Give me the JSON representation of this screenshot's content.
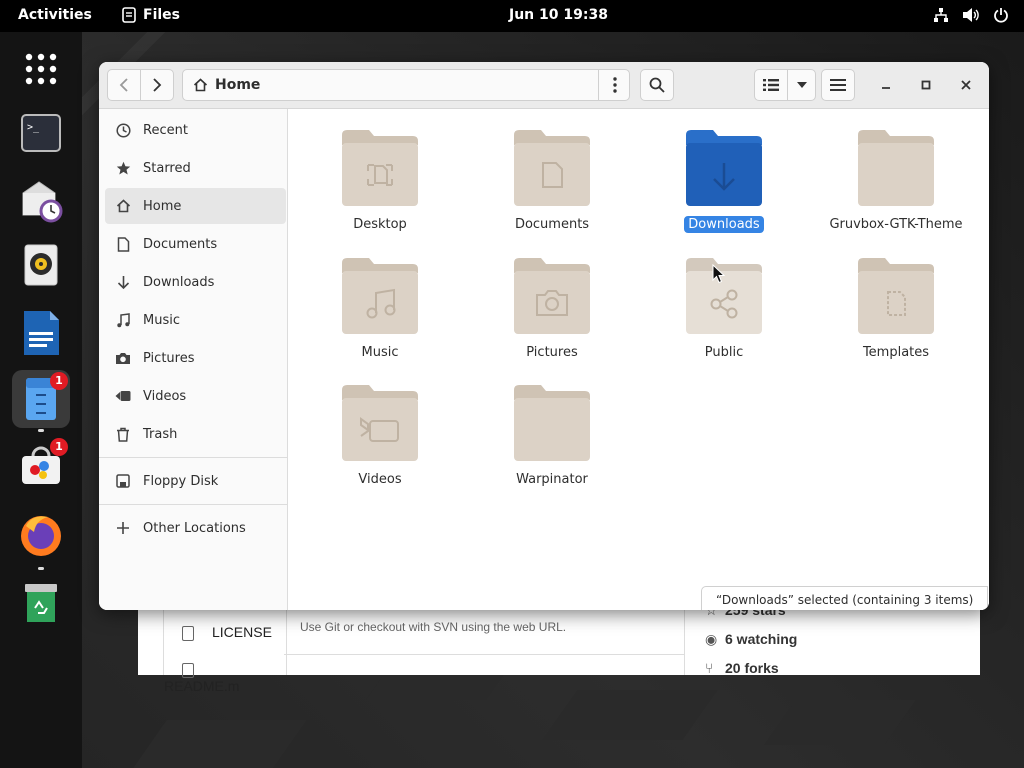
{
  "topbar": {
    "activities": "Activities",
    "app_name": "Files",
    "clock": "Jun 10  19:38"
  },
  "dock": {
    "items": [
      {
        "name": "app-grid-icon"
      },
      {
        "name": "terminal-icon"
      },
      {
        "name": "mail-clock-icon"
      },
      {
        "name": "rhythmbox-icon"
      },
      {
        "name": "writer-icon"
      },
      {
        "name": "files-icon",
        "badge": "1"
      },
      {
        "name": "software-icon",
        "badge": "1"
      },
      {
        "name": "firefox-icon"
      },
      {
        "name": "trash-icon"
      }
    ]
  },
  "window": {
    "path": "Home",
    "sidebar": [
      {
        "label": "Recent",
        "icon": "clock-icon"
      },
      {
        "label": "Starred",
        "icon": "star-icon"
      },
      {
        "label": "Home",
        "icon": "home-icon"
      },
      {
        "label": "Documents",
        "icon": "document-icon"
      },
      {
        "label": "Downloads",
        "icon": "download-icon"
      },
      {
        "label": "Music",
        "icon": "music-icon"
      },
      {
        "label": "Pictures",
        "icon": "camera-icon"
      },
      {
        "label": "Videos",
        "icon": "video-icon"
      },
      {
        "label": "Trash",
        "icon": "trash-icon"
      },
      {
        "label": "Floppy Disk",
        "icon": "floppy-icon"
      },
      {
        "label": "Other Locations",
        "icon": "plus-icon"
      }
    ],
    "folders": [
      {
        "label": "Desktop"
      },
      {
        "label": "Documents"
      },
      {
        "label": "Downloads"
      },
      {
        "label": "Gruvbox-GTK-Theme"
      },
      {
        "label": "Music"
      },
      {
        "label": "Pictures"
      },
      {
        "label": "Public"
      },
      {
        "label": "Templates"
      },
      {
        "label": "Videos"
      },
      {
        "label": "Warpinator"
      }
    ],
    "status": "“Downloads” selected  (containing 3 items)"
  },
  "background_window": {
    "files": [
      "LICENSE",
      "README.m"
    ],
    "hint": "Use Git or checkout with SVN using the web URL.",
    "stats": [
      "259 stars",
      "6 watching",
      "20 forks"
    ]
  },
  "colors": {
    "accent": "#3584e4",
    "folder": "#dcd2c6",
    "folder_tab": "#cfc3b4",
    "selected_folder": "#2a6fc9"
  }
}
